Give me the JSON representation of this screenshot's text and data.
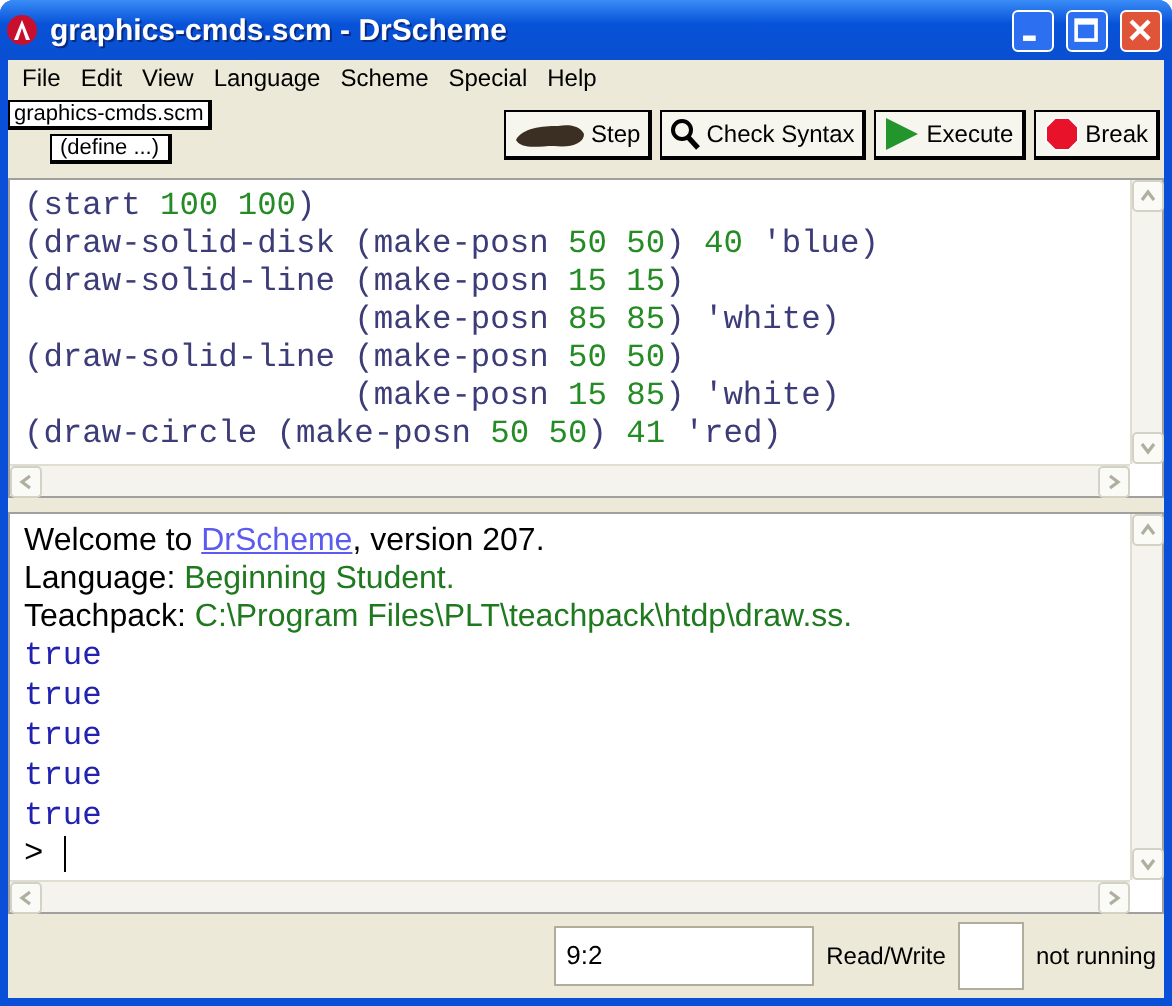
{
  "window": {
    "title": "graphics-cmds.scm - DrScheme"
  },
  "menu": [
    "File",
    "Edit",
    "View",
    "Language",
    "Scheme",
    "Special",
    "Help"
  ],
  "toolbar": {
    "file_name": "graphics-cmds.scm",
    "define_menu": "(define ...)",
    "buttons": [
      {
        "label": "Step",
        "kind": "step"
      },
      {
        "label": "Check Syntax",
        "kind": "check"
      },
      {
        "label": "Execute",
        "kind": "execute"
      },
      {
        "label": "Break",
        "kind": "break"
      }
    ]
  },
  "editor": {
    "lines": [
      [
        {
          "t": "(start ",
          "kind": "code"
        },
        {
          "t": "100 100",
          "kind": "number"
        },
        {
          "t": ")",
          "kind": "code"
        }
      ],
      [
        {
          "t": "(draw-solid-disk (make-posn ",
          "kind": "code"
        },
        {
          "t": "50 50",
          "kind": "number"
        },
        {
          "t": ") ",
          "kind": "code"
        },
        {
          "t": "40",
          "kind": "number"
        },
        {
          "t": " 'blue)",
          "kind": "code"
        }
      ],
      [
        {
          "t": "(draw-solid-line (make-posn ",
          "kind": "code"
        },
        {
          "t": "15 15",
          "kind": "number"
        },
        {
          "t": ")",
          "kind": "code"
        }
      ],
      [
        {
          "t": "                 (make-posn ",
          "kind": "code"
        },
        {
          "t": "85 85",
          "kind": "number"
        },
        {
          "t": ") 'white)",
          "kind": "code"
        }
      ],
      [
        {
          "t": "(draw-solid-line (make-posn ",
          "kind": "code"
        },
        {
          "t": "50 50",
          "kind": "number"
        },
        {
          "t": ")",
          "kind": "code"
        }
      ],
      [
        {
          "t": "                 (make-posn ",
          "kind": "code"
        },
        {
          "t": "15 85",
          "kind": "number"
        },
        {
          "t": ") 'white)",
          "kind": "code"
        }
      ],
      [
        {
          "t": "(draw-circle (make-posn ",
          "kind": "code"
        },
        {
          "t": "50 50",
          "kind": "number"
        },
        {
          "t": ") ",
          "kind": "code"
        },
        {
          "t": "41",
          "kind": "number"
        },
        {
          "t": " 'red)",
          "kind": "code"
        }
      ]
    ]
  },
  "interactions": {
    "lines": [
      [
        {
          "t": "Welcome to ",
          "kind": "text"
        },
        {
          "t": "DrScheme",
          "kind": "link"
        },
        {
          "t": ", version 207.",
          "kind": "text"
        }
      ],
      [
        {
          "t": "Language: ",
          "kind": "text"
        },
        {
          "t": "Beginning Student.",
          "kind": "info"
        }
      ],
      [
        {
          "t": "Teachpack: ",
          "kind": "text"
        },
        {
          "t": "C:\\Program Files\\PLT\\teachpack\\htdp\\draw.ss.",
          "kind": "info"
        }
      ],
      [
        {
          "t": "true",
          "kind": "result"
        }
      ],
      [
        {
          "t": "true",
          "kind": "result"
        }
      ],
      [
        {
          "t": "true",
          "kind": "result"
        }
      ],
      [
        {
          "t": "true",
          "kind": "result"
        }
      ],
      [
        {
          "t": "true",
          "kind": "result"
        }
      ]
    ],
    "prompt": ">"
  },
  "status_bar": {
    "position": "9:2",
    "mode": "Read/Write",
    "state": "not running"
  }
}
